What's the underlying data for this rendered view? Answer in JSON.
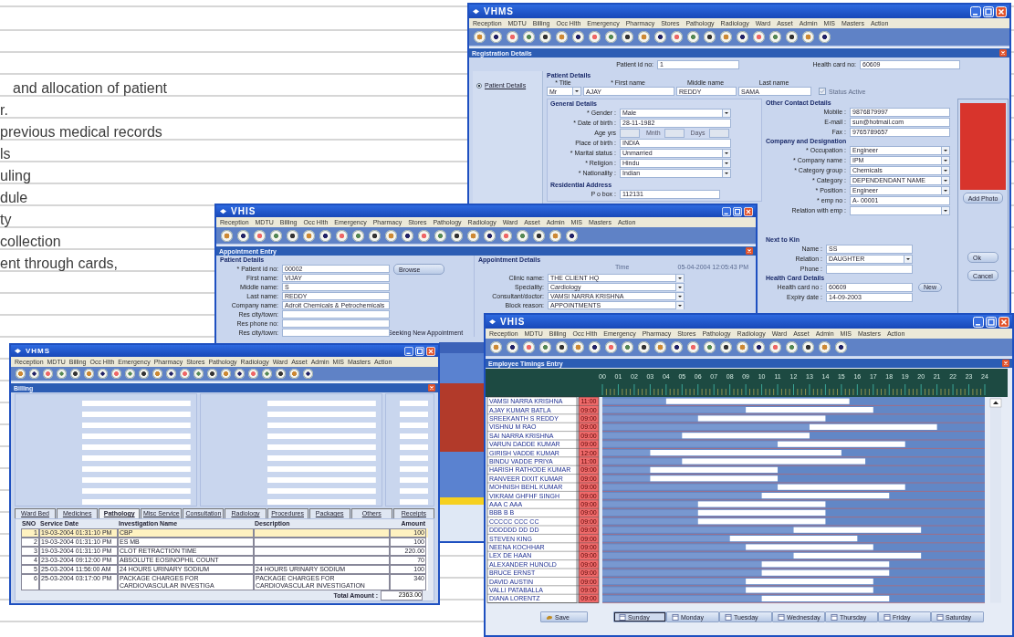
{
  "page_text": [
    "and allocation of patient",
    "r.",
    "previous medical records",
    "ls",
    "uling",
    "dule",
    "ty",
    "collection",
    "ent through cards,"
  ],
  "windows": [
    {
      "kind": "registration",
      "title": "VHMS",
      "menu": [
        "Reception",
        "MDTU",
        "Billing",
        "Occ Hlth",
        "Emergency",
        "Pharmacy",
        "Stores",
        "Pathology",
        "Radiology",
        "Ward",
        "Asset",
        "Admin",
        "MIS",
        "Masters",
        "Action"
      ],
      "panel_title": "Registration Details",
      "patient_id": {
        "label": "Patient id no:",
        "value": "1"
      },
      "health_card": {
        "label": "Health card no:",
        "value": "60609"
      },
      "nav": [
        {
          "label": "Patient Details",
          "selected": true
        }
      ],
      "patient_details": {
        "heading": "Patient Details",
        "columns": [
          {
            "label": "* Title",
            "value": "Mr",
            "kind": "select"
          },
          {
            "label": "* First name",
            "value": "AJAY",
            "kind": "text"
          },
          {
            "label": "Middle name",
            "value": "REDDY",
            "kind": "text"
          },
          {
            "label": "Last name",
            "value": "SAMA",
            "kind": "text"
          }
        ],
        "status": {
          "label": "Status Active",
          "checked": true,
          "disabled": true
        }
      },
      "general": {
        "heading": "General Details",
        "fields": [
          {
            "label": "* Gender :",
            "value": "Male",
            "kind": "select"
          },
          {
            "label": "* Date of birth :",
            "value": "28-11-1982",
            "kind": "text"
          },
          {
            "label": "Age yrs",
            "kind": "age",
            "parts": [
              "Mnth",
              "Days"
            ]
          },
          {
            "label": "Place of birth :",
            "value": "INDIA",
            "kind": "text"
          },
          {
            "label": "* Marital status :",
            "value": "Unmarried",
            "kind": "select"
          },
          {
            "label": "* Religion :",
            "value": "Hindu",
            "kind": "select"
          },
          {
            "label": "* Nationality :",
            "value": "Indian",
            "kind": "select"
          }
        ]
      },
      "residential": {
        "heading": "Residential Address",
        "fields": [
          {
            "label": "P o box :",
            "value": "112131"
          }
        ]
      },
      "contact": {
        "heading": "Other Contact Details",
        "fields": [
          {
            "label": "Mobile :",
            "value": "9876879997"
          },
          {
            "label": "E-mail :",
            "value": "sun@hotmail.com"
          },
          {
            "label": "Fax :",
            "value": "9765789657"
          }
        ]
      },
      "company": {
        "heading": "Company and Designation",
        "fields": [
          {
            "label": "* Occupation :",
            "value": "Engineer",
            "kind": "select"
          },
          {
            "label": "* Company name :",
            "value": "IPM",
            "kind": "select"
          },
          {
            "label": "* Category group :",
            "value": "Chemicals",
            "kind": "select"
          },
          {
            "label": "* Category :",
            "value": "DEPENDENDANT NAME",
            "kind": "select"
          },
          {
            "label": "* Position :",
            "value": "Engineer",
            "kind": "select"
          },
          {
            "label": "* emp no :",
            "value": "A- 00001",
            "kind": "text"
          },
          {
            "label": "Relation with emp :",
            "kind": "select"
          }
        ]
      },
      "photo_button": "Add Photo",
      "next_of_kin": {
        "heading": "Next to Kin",
        "fields": [
          {
            "label": "Name :",
            "value": "SS",
            "kind": "text"
          },
          {
            "label": "Relation :",
            "value": "DAUGHTER",
            "kind": "select"
          },
          {
            "label": "Phone :",
            "kind": "text"
          }
        ]
      },
      "health_card_details": {
        "heading": "Health Card Details",
        "fields": [
          {
            "label": "Health card no :",
            "value": "60609"
          },
          {
            "label": "Expiry date :",
            "value": "14-09-2003"
          }
        ],
        "new_button": "New"
      },
      "buttons": [
        "Ok",
        "Cancel"
      ]
    },
    {
      "kind": "appointment",
      "title": "VHIS",
      "menu": [
        "Reception",
        "MDTU",
        "Billing",
        "Occ Hlth",
        "Emergency",
        "Pharmacy",
        "Stores",
        "Pathology",
        "Radiology",
        "Ward",
        "Asset",
        "Admin",
        "MIS",
        "Masters",
        "Action"
      ],
      "panel_title": "Appointment Entry",
      "patient": {
        "heading": "Patient Details",
        "fields": [
          {
            "label": "* Patient id no:",
            "value": "00002"
          },
          {
            "label": "First name:",
            "value": "VIJAY"
          },
          {
            "label": "Middle name:",
            "value": "S"
          },
          {
            "label": "Last name:",
            "value": "REDDY"
          },
          {
            "label": "Company name:",
            "value": "Adroit Chemicals & Petrochemicals"
          },
          {
            "label": "Res city/town:"
          },
          {
            "label": "Res phone no:"
          },
          {
            "label": "Res city/town:"
          }
        ]
      },
      "browse_button": "Browse",
      "status_text": "Seeking New Appointment",
      "appointment": {
        "heading": "Appointment Details",
        "time_label": "Time",
        "time_value": "05-04-2004 12:05:43 PM",
        "fields": [
          {
            "label": "Clinic name:",
            "value": "THE CLIENT HQ"
          },
          {
            "label": "Speciality:",
            "value": "Cardiology"
          },
          {
            "label": "Consultant/doctor:",
            "value": "VAMSI NARRA KRISHNA"
          },
          {
            "label": "Block reason:",
            "value": "APPOINTMENTS"
          }
        ]
      }
    },
    {
      "kind": "billing",
      "title": "VHMS",
      "menu": [
        "Reception",
        "MDTU",
        "Billing",
        "Occ Hlth",
        "Emergency",
        "Pharmacy",
        "Stores",
        "Pathology",
        "Radiology",
        "Ward",
        "Asset",
        "Admin",
        "MIS",
        "Masters",
        "Action"
      ],
      "panel_title": "Billing",
      "tabs": [
        {
          "label": "Ward Bed",
          "selected": false
        },
        {
          "label": "Medicines",
          "selected": false
        },
        {
          "label": "Pathology",
          "selected": true
        },
        {
          "label": "Misc Service",
          "selected": false
        },
        {
          "label": "Consultation",
          "selected": false
        },
        {
          "label": "Radiology",
          "selected": false
        },
        {
          "label": "Procedures",
          "selected": false
        },
        {
          "label": "Packages",
          "selected": false
        },
        {
          "label": "Others",
          "selected": false
        },
        {
          "label": "Receipts",
          "selected": false
        }
      ],
      "table": {
        "columns": [
          "SNO",
          "Service Date",
          "Investigation Name",
          "Description",
          "Amount"
        ],
        "rows": [
          {
            "cells": [
              "1",
              "19-03-2004 01:31:10 PM",
              "CBP",
              "",
              "100"
            ],
            "selected": true
          },
          {
            "cells": [
              "2",
              "19-03-2004 01:31:10 PM",
              "ES MB",
              "",
              "100"
            ],
            "selected": false
          },
          {
            "cells": [
              "3",
              "19-03-2004 01:31:10 PM",
              "CLOT RETRACTION TIME",
              "",
              "220.00"
            ],
            "selected": false
          },
          {
            "cells": [
              "4",
              "23-03-2004 09:12:00 PM",
              "ABSOLUTE EOSINOPHIL COUNT",
              "",
              "70"
            ],
            "selected": false
          },
          {
            "cells": [
              "5",
              "25-03-2004 11:56:00 AM",
              "24 HOURS URINARY SODIUM",
              "24 HOURS URINARY SODIUM",
              "100"
            ],
            "selected": false
          },
          {
            "cells": [
              "6",
              "25-03-2004 03:17:00 PM",
              "PACKAGE CHARGES FOR CARDIOVASCULAR INVESTIGA",
              "PACKAGE CHARGES FOR CARDIOVASCULAR INVESTIGATION",
              "340"
            ],
            "selected": false
          }
        ]
      },
      "total": {
        "label": "Total Amount :",
        "value": "2363.00"
      }
    },
    {
      "kind": "timings",
      "title": "VHIS",
      "menu": [
        "Reception",
        "MDTU",
        "Billing",
        "Occ Hlth",
        "Emergency",
        "Pharmacy",
        "Stores",
        "Pathology",
        "Radiology",
        "Ward",
        "Asset",
        "Admin",
        "MIS",
        "Masters",
        "Action"
      ],
      "panel_title": "Employee Timings Entry",
      "chart_data": {
        "type": "bar",
        "orientation": "horizontal",
        "stacked": true,
        "categories": [
          "VAMSI NARRA KRISHNA",
          "AJAY KUMAR BATLA",
          "SREEKANTH S REDDY",
          "VISHNU M RAO",
          "SAI NARRA KRISHNA",
          "VARUN DADDE KUMAR",
          "GIRISH VADDE KUMAR",
          "BINDU VADDE PRIYA",
          "HARISH RATHODE KUMAR",
          "RANVEER DIXIT KUMAR",
          "MOHNISH BEHL KUMAR",
          "VIKRAM GHFHF SINGH",
          "AAA C AAA",
          "BBB B B",
          "CCCCC CCC CC",
          "DDDDDD DD DD",
          "STEVEN KING",
          "NEENA KOCHHAR",
          "LEX DE HAAN",
          "ALEXANDER HUNOLD",
          "BRUCE ERNST",
          "DAVID AUSTIN",
          "VALLI PATABALLA",
          "DIANA LORENTZ"
        ],
        "series": [
          {
            "color": "#7898d0",
            "values": [
              4,
              9,
              6,
              13,
              5,
              11,
              3,
              5,
              3,
              3,
              11,
              10,
              6,
              6,
              6,
              12,
              8,
              9,
              12,
              10,
              10,
              9,
              9,
              10
            ]
          },
          {
            "color": "#ffffff",
            "values": [
              11.5,
              8,
              8,
              8,
              8,
              8,
              12,
              11.5,
              8,
              8,
              8,
              8,
              8,
              8,
              8,
              8,
              8,
              8,
              8,
              8,
              8,
              8,
              8,
              8
            ]
          }
        ],
        "xlim": [
          0,
          24
        ],
        "xticks": [
          {
            "value": 0,
            "label": "00"
          },
          {
            "value": 1,
            "label": "01"
          },
          {
            "value": 2,
            "label": "02"
          },
          {
            "value": 3,
            "label": "03"
          },
          {
            "value": 4,
            "label": "04"
          },
          {
            "value": 5,
            "label": "05"
          },
          {
            "value": 6,
            "label": "06"
          },
          {
            "value": 7,
            "label": "07"
          },
          {
            "value": 8,
            "label": "08"
          },
          {
            "value": 9,
            "label": "09"
          },
          {
            "value": 10,
            "label": "10"
          },
          {
            "value": 11,
            "label": "11"
          },
          {
            "value": 12,
            "label": "12"
          },
          {
            "value": 13,
            "label": "13"
          },
          {
            "value": 14,
            "label": "14"
          },
          {
            "value": 15,
            "label": "15"
          },
          {
            "value": 16,
            "label": "16"
          },
          {
            "value": 17,
            "label": "17"
          },
          {
            "value": 18,
            "label": "18"
          },
          {
            "value": 19,
            "label": "19"
          },
          {
            "value": 20,
            "label": "20"
          },
          {
            "value": 21,
            "label": "21"
          },
          {
            "value": 22,
            "label": "22"
          },
          {
            "value": 23,
            "label": "23"
          },
          {
            "value": 24,
            "label": "24"
          }
        ]
      },
      "times": [
        "11:00",
        "09:00",
        "09:00",
        "09:00",
        "09:00",
        "09:00",
        "12:00",
        "11:00",
        "09:00",
        "09:00",
        "09:00",
        "09:00",
        "09:00",
        "09:00",
        "09:00",
        "09:00",
        "09:00",
        "09:00",
        "09:00",
        "09:00",
        "09:00",
        "09:00",
        "09:00",
        "09:00"
      ],
      "save_button": "Save",
      "days": [
        {
          "label": "Sunday",
          "selected": true
        },
        {
          "label": "Monday",
          "selected": false
        },
        {
          "label": "Tuesday",
          "selected": false
        },
        {
          "label": "Wednesday",
          "selected": false
        },
        {
          "label": "Thursday",
          "selected": false
        },
        {
          "label": "Friday",
          "selected": false
        },
        {
          "label": "Saturday",
          "selected": false
        }
      ]
    }
  ]
}
